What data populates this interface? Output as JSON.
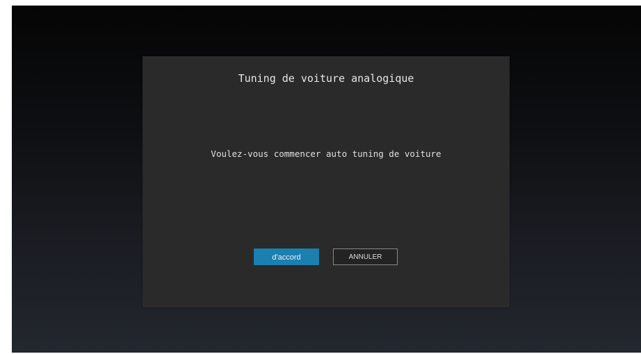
{
  "dialog": {
    "title": "Tuning de voiture analogique",
    "message": "Voulez-vous commencer auto tuning de voiture",
    "ok_label": "d'accord",
    "cancel_label": "ANNULER",
    "focused_button": "ok"
  },
  "colors": {
    "dialog_background": "#2a2a2a",
    "primary_button": "#1b7fb0",
    "text": "#e8e8e8"
  }
}
